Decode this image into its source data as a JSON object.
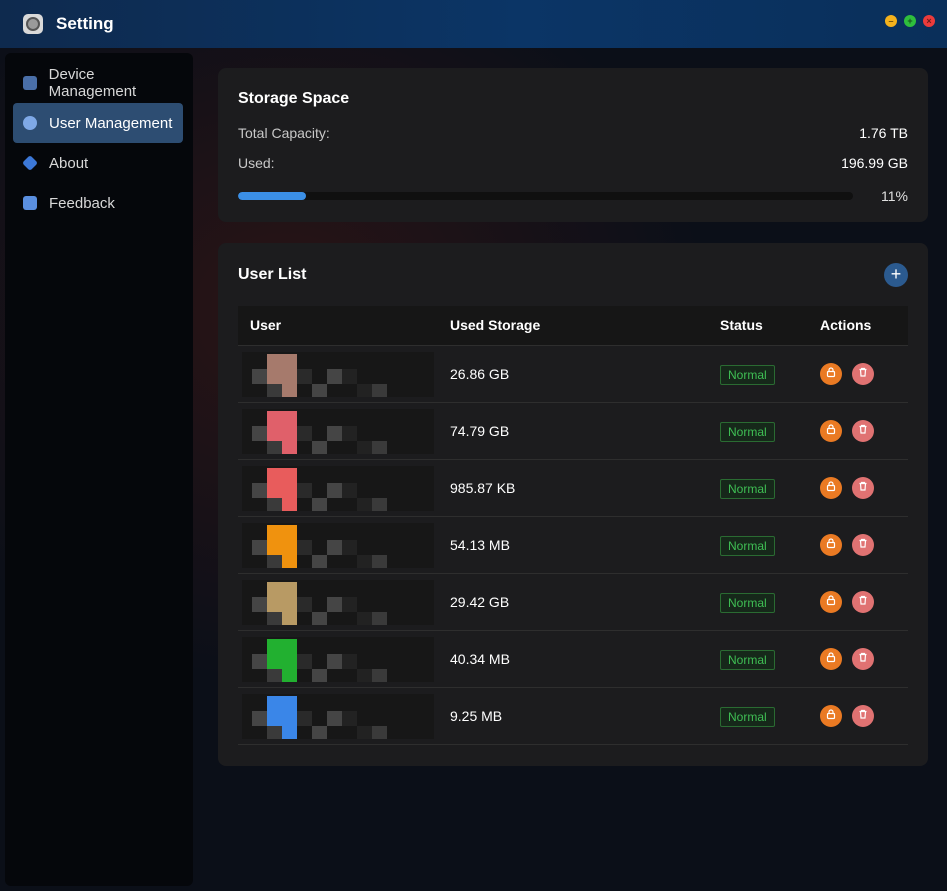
{
  "window": {
    "title": "Setting"
  },
  "sidebar": {
    "items": [
      {
        "label": "Device Management",
        "icon": "device-icon",
        "active": false
      },
      {
        "label": "User Management",
        "icon": "users-icon",
        "active": true
      },
      {
        "label": "About",
        "icon": "info-icon",
        "active": false
      },
      {
        "label": "Feedback",
        "icon": "feedback-icon",
        "active": false
      }
    ]
  },
  "storage": {
    "title": "Storage Space",
    "total_label": "Total Capacity:",
    "total_value": "1.76 TB",
    "used_label": "Used:",
    "used_value": "196.99 GB",
    "progress_percent": 11,
    "progress_label": "11%"
  },
  "users": {
    "title": "User List",
    "add_icon": "plus-icon",
    "columns": {
      "user": "User",
      "storage": "Used Storage",
      "status": "Status",
      "actions": "Actions"
    },
    "rows": [
      {
        "storage": "26.86 GB",
        "status": "Normal",
        "avatar_color": "#a67a6c"
      },
      {
        "storage": "74.79 GB",
        "status": "Normal",
        "avatar_color": "#e0606a"
      },
      {
        "storage": "985.87 KB",
        "status": "Normal",
        "avatar_color": "#e85c5c"
      },
      {
        "storage": "54.13 MB",
        "status": "Normal",
        "avatar_color": "#f0920e"
      },
      {
        "storage": "29.42 GB",
        "status": "Normal",
        "avatar_color": "#b89a64"
      },
      {
        "storage": "40.34 MB",
        "status": "Normal",
        "avatar_color": "#22b030"
      },
      {
        "storage": "9.25 MB",
        "status": "Normal",
        "avatar_color": "#3a86e8"
      }
    ]
  },
  "colors": {
    "accent": "#3b8fe6",
    "active_nav": "#2d4d72",
    "status_normal": "#3fbf54",
    "lock_button": "#ea7a23",
    "delete_button": "#e07272"
  }
}
